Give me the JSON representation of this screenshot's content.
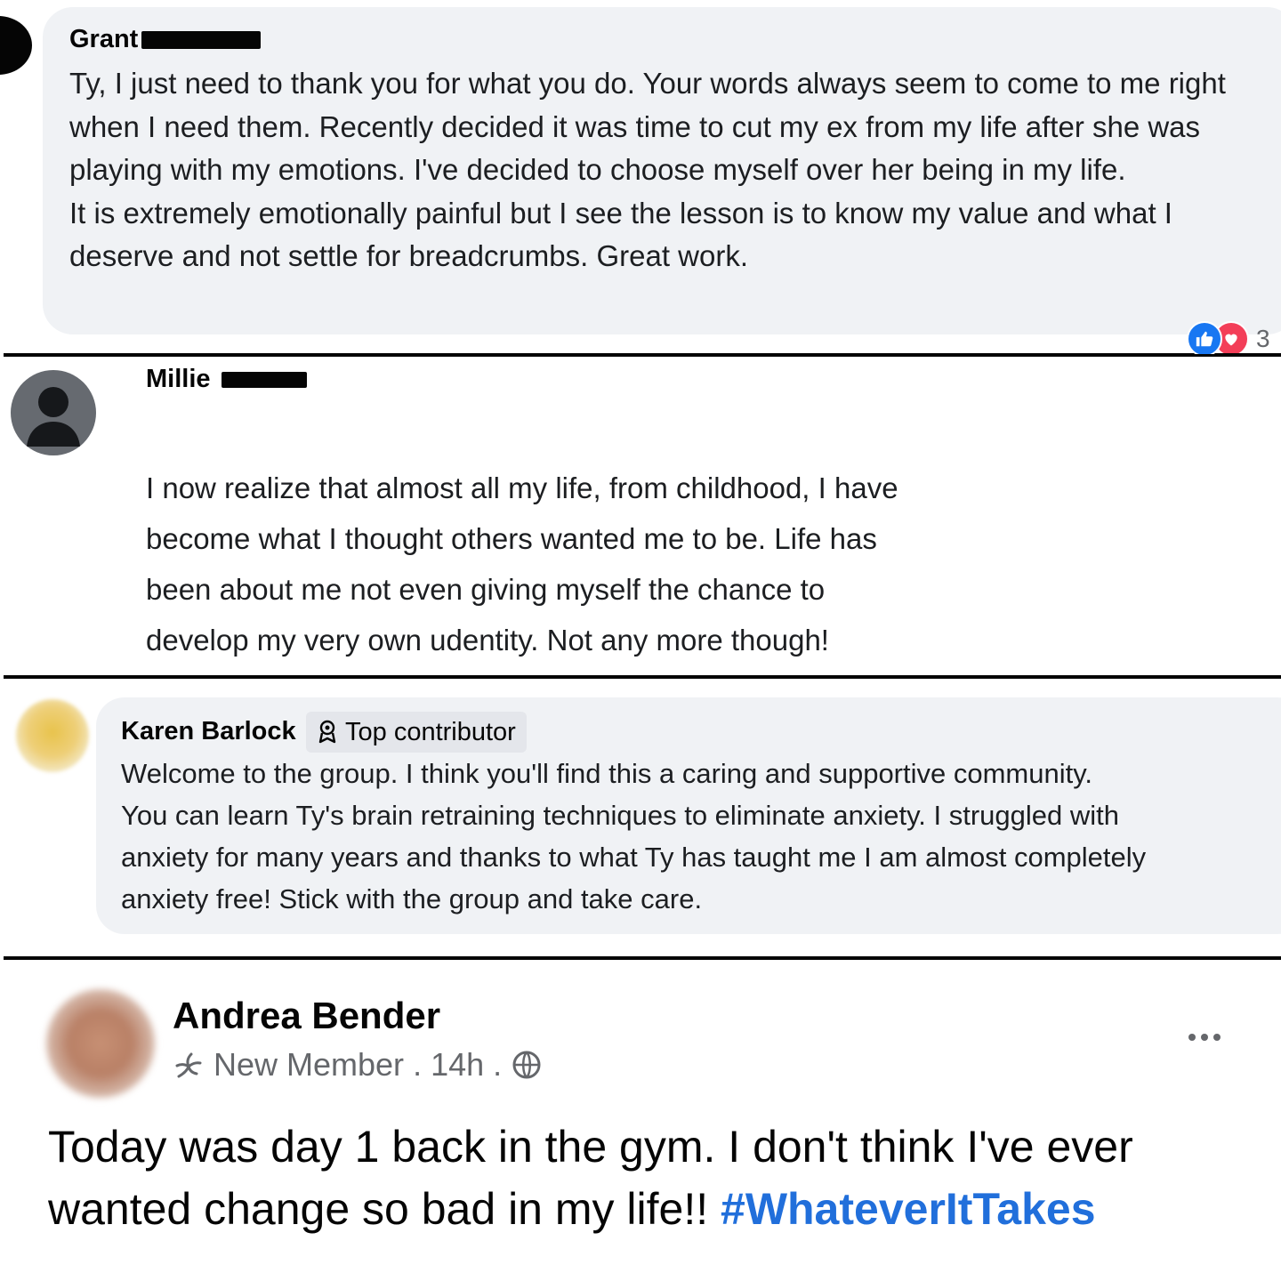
{
  "comments": [
    {
      "author": "Grant",
      "text": "Ty, I just need to thank you for what you do. Your words always seem to come to me right when I need them. Recently decided it was time to cut my ex from my life after she was playing with my emotions. I've decided to choose myself over her being in my life.\nIt is extremely emotionally painful but I see the lesson is to know my value and what I deserve and not settle for breadcrumbs. Great work.",
      "reactions": [
        "like",
        "love"
      ],
      "reaction_count": "3"
    },
    {
      "author": "Millie",
      "text": "I now realize that almost all my life, from childhood, I have\nbecome what I thought others wanted me to be. Life has\nbeen about me not even giving myself the chance to\ndevelop my very own udentity. Not any more though!"
    },
    {
      "author": "Karen Barlock",
      "badge": "Top contributor",
      "text": "Welcome to the group. I think you'll find this a caring and supportive community.\nYou can learn Ty's brain retraining techniques to eliminate anxiety. I struggled with\nanxiety for many years and thanks to what Ty has taught me I am almost completely\nanxiety free! Stick with the group and take care."
    }
  ],
  "post": {
    "author": "Andrea Bender",
    "member_label": "New Member",
    "separator": ".",
    "time": "14h",
    "text": "Today was day 1 back in the gym.  I don't think I've ever wanted change so bad in my life!! ",
    "hashtag": "#WhateverItTakes"
  },
  "icons": [
    "like-icon",
    "love-icon",
    "top-contributor-icon",
    "new-member-icon",
    "globe-icon",
    "more-options-icon"
  ],
  "colors": {
    "bubble": "#f0f2f5",
    "like": "#1877f2",
    "love": "#f33e58",
    "hashtag": "#216fdb",
    "secondary_text": "#65676b"
  }
}
